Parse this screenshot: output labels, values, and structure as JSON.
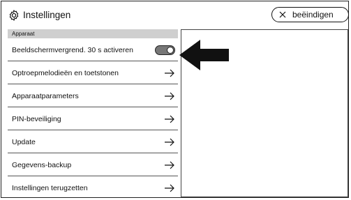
{
  "header": {
    "title": "Instellingen",
    "title_icon": "gear-icon",
    "end_button": {
      "label": "beëindigen",
      "icon": "close-icon"
    }
  },
  "group": {
    "label": "Apparaat"
  },
  "items": [
    {
      "label": "Beeldschermvergrend. 30 s activeren",
      "control": "toggle",
      "toggle_on": true
    },
    {
      "label": "Optroepmelodieën en toetstonen",
      "control": "arrow"
    },
    {
      "label": "Apparaatparameters",
      "control": "arrow"
    },
    {
      "label": "PIN-beveiliging",
      "control": "arrow"
    },
    {
      "label": "Update",
      "control": "arrow"
    },
    {
      "label": "Gegevens-backup",
      "control": "arrow"
    },
    {
      "label": "Instellingen terugzetten",
      "control": "arrow"
    }
  ],
  "colors": {
    "group_header_bg": "#cfcfcf",
    "toggle_bg": "#777777",
    "annotation_arrow": "#111111"
  }
}
